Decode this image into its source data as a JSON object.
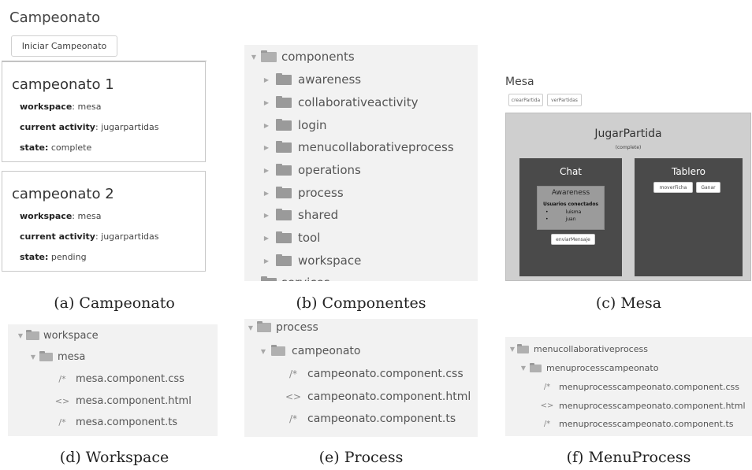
{
  "campeonato": {
    "title": "Campeonato",
    "button_label": "Iniciar Campeonato",
    "cards": [
      {
        "name": "campeonato 1",
        "workspace_label": "workspace",
        "workspace": ": mesa",
        "activity_label": "current activity",
        "activity": ": jugarpartidas",
        "state_label": "state:",
        "state": " complete"
      },
      {
        "name": "campeonato 2",
        "workspace_label": "workspace",
        "workspace": ": mesa",
        "activity_label": "current activity",
        "activity": ": jugarpartidas",
        "state_label": "state:",
        "state": " pending"
      }
    ],
    "caption": "(a) Campeonato"
  },
  "componentes": {
    "root": "components",
    "folders": [
      "awareness",
      "collaborativeactivity",
      "login",
      "menucollaborativeprocess",
      "operations",
      "process",
      "shared",
      "tool",
      "workspace"
    ],
    "partial": "services",
    "caption": "(b) Componentes"
  },
  "mesa": {
    "title": "Mesa",
    "buttons": [
      "crearPartida",
      "verPartidas"
    ],
    "activity_title": "JugarPartida",
    "activity_state": "(complete)",
    "chat": {
      "title": "Chat",
      "awareness_title": "Awareness",
      "users_label": "Usuarios conectados",
      "users": [
        "luisma",
        "juan"
      ],
      "send_button": "enviarMensaje"
    },
    "tablero": {
      "title": "Tablero",
      "buttons": [
        "moverFicha",
        "Ganar"
      ]
    },
    "caption": "(c) Mesa"
  },
  "workspace_tree": {
    "root": "workspace",
    "folder": "mesa",
    "files": [
      {
        "icon": "/*",
        "name": "mesa.component.css"
      },
      {
        "icon": "<>",
        "name": "mesa.component.html"
      },
      {
        "icon": "/*",
        "name": "mesa.component.ts"
      }
    ],
    "caption": "(d) Workspace"
  },
  "process_tree": {
    "root": "process",
    "folder": "campeonato",
    "files": [
      {
        "icon": "/*",
        "name": "campeonato.component.css"
      },
      {
        "icon": "<>",
        "name": "campeonato.component.html"
      },
      {
        "icon": "/*",
        "name": "campeonato.component.ts"
      }
    ],
    "caption": "(e) Process"
  },
  "menuprocess_tree": {
    "root": "menucollaborativeprocess",
    "folder": "menuprocesscampeonato",
    "files": [
      {
        "icon": "/*",
        "name": "menuprocesscampeonato.component.css"
      },
      {
        "icon": "<>",
        "name": "menuprocesscampeonato.component.html"
      },
      {
        "icon": "/*",
        "name": "menuprocesscampeonato.component.ts"
      }
    ],
    "caption": "(f) MenuProcess"
  },
  "colors": {
    "tree_bg": "#f2f2f2",
    "mesa_frame": "#cfcfcf",
    "dark_box": "#4a4a4a",
    "awareness_bg": "#9b9b9b",
    "folder": "#9a9a9a"
  }
}
